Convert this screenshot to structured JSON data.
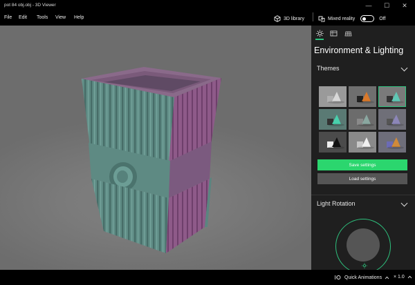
{
  "window": {
    "title": "pot 84 obj.obj - 3D Viewer",
    "minimize_glyph": "—",
    "maximize_glyph": "☐",
    "close_glyph": "✕"
  },
  "menu": {
    "items": [
      "File",
      "Edit",
      "Tools",
      "View",
      "Help"
    ]
  },
  "toolbar": {
    "library_label": "3D library",
    "mixed_reality_label": "Mixed reality",
    "toggle_state": "Off"
  },
  "panel": {
    "tabs": [
      "lighting-tab",
      "stats-tab",
      "grid-tab"
    ],
    "title": "Environment & Lighting",
    "themes_label": "Themes",
    "themes": [
      {
        "bg": "#9a9a9a",
        "shape": "#d8d8d8",
        "accent": "#b0b0b0"
      },
      {
        "bg": "#6f6f6f",
        "shape": "#d9792b",
        "accent": "#222222"
      },
      {
        "bg": "#7a7a7a",
        "shape": "#5fc7b4",
        "accent": "#333333",
        "selected": true
      },
      {
        "bg": "#5a7a74",
        "shape": "#49d0ac",
        "accent": "#333333"
      },
      {
        "bg": "#6c6c6c",
        "shape": "#8aa7a0",
        "accent": "#8a8a8a"
      },
      {
        "bg": "#6f6f78",
        "shape": "#8c86b8",
        "accent": "#555555"
      },
      {
        "bg": "#4b4b4b",
        "shape": "#111111",
        "accent": "#eeeeee"
      },
      {
        "bg": "#8a8a8a",
        "shape": "#f0f0f0",
        "accent": "#c8c8c8"
      },
      {
        "bg": "#6e6e7a",
        "shape": "#d08a3a",
        "accent": "#6b6bb5"
      }
    ],
    "save_label": "Save settings",
    "load_label": "Load settings",
    "rotation_label": "Light Rotation"
  },
  "statusbar": {
    "animations_label": "Quick Animations",
    "zoom_label": "× 1.0"
  },
  "colors": {
    "accent": "#2ec27e",
    "save_button": "#2bd66e",
    "model_teal": "#5e8e86",
    "model_magenta": "#9a5a93"
  }
}
